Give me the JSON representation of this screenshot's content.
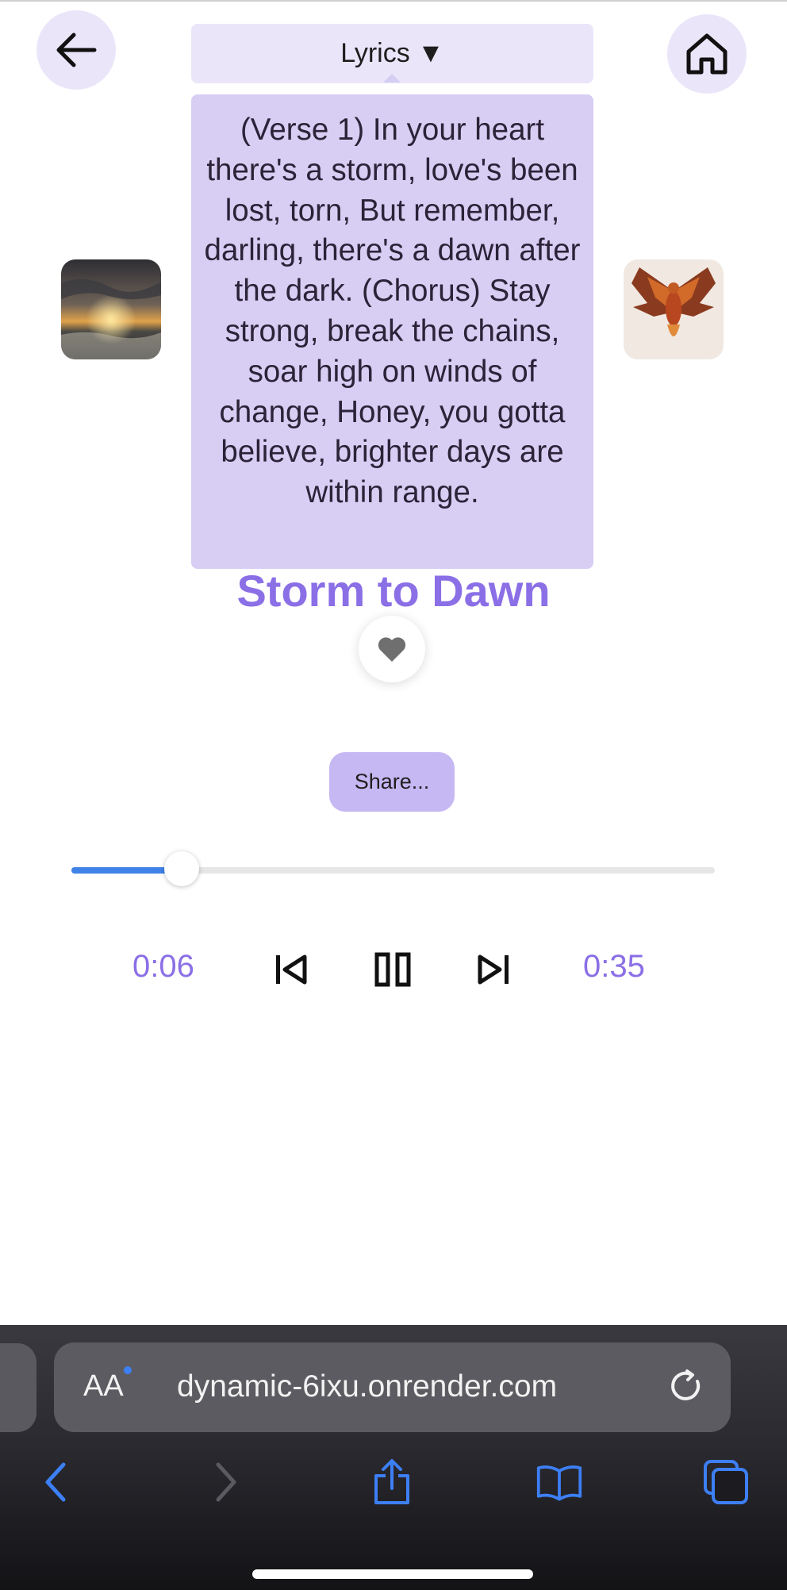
{
  "header": {
    "back_icon": "arrow-left-icon",
    "home_icon": "home-icon",
    "lyrics_toggle_label": "Lyrics ▼"
  },
  "lyrics": {
    "text": "(Verse 1) In your heart there's a storm, love's been lost, torn, But remember, darling, there's a dawn after the dark. (Chorus) Stay strong, break the chains, soar high on winds of change, Honey, you gotta believe, brighter days are within range."
  },
  "song": {
    "title": "Storm to Dawn",
    "left_image": "sunset-storm-sea-image",
    "right_image": "phoenix-image",
    "like_icon": "heart-icon"
  },
  "share": {
    "label": "Share..."
  },
  "player": {
    "current_time": "0:06",
    "total_time": "0:35",
    "progress": 0.1714,
    "prev_icon": "skip-previous-icon",
    "pause_icon": "pause-icon",
    "next_icon": "skip-next-icon"
  },
  "browser": {
    "text_size_button": "AA",
    "url": "dynamic-6ixu.onrender.com",
    "reload_icon": "reload-icon",
    "toolbar": [
      "back-icon",
      "forward-icon",
      "share-icon",
      "bookmarks-icon",
      "tabs-icon"
    ]
  },
  "colors": {
    "accent_purple": "#8b6fe6",
    "lyrics_bg": "#d8cdf3",
    "button_bg": "#ebe5fa",
    "progress_blue": "#3f82e8"
  }
}
